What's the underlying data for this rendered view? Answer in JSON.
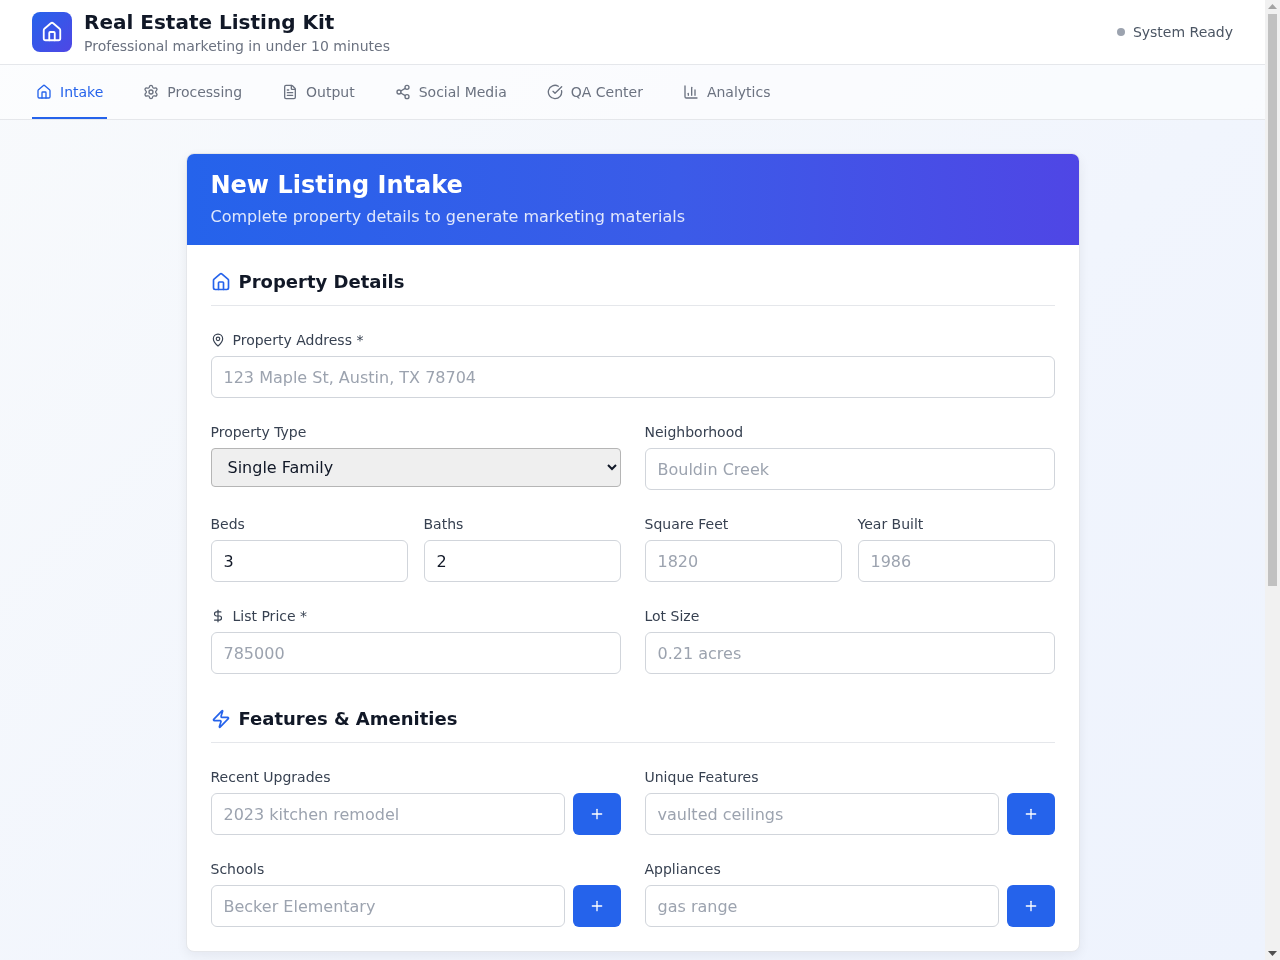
{
  "app": {
    "title": "Real Estate Listing Kit",
    "subtitle": "Professional marketing in under 10 minutes",
    "status": "System Ready"
  },
  "tabs": [
    {
      "label": "Intake",
      "selected": true
    },
    {
      "label": "Processing",
      "selected": false
    },
    {
      "label": "Output",
      "selected": false
    },
    {
      "label": "Social Media",
      "selected": false
    },
    {
      "label": "QA Center",
      "selected": false
    },
    {
      "label": "Analytics",
      "selected": false
    }
  ],
  "form": {
    "title": "New Listing Intake",
    "subtitle": "Complete property details to generate marketing materials",
    "sections": [
      {
        "heading": "Property Details",
        "rows": [
          {
            "fields": [
              {
                "kind": "address",
                "label": "Property Address *",
                "placeholder": "123 Maple St, Austin, TX 78704"
              }
            ]
          },
          {
            "fields": [
              {
                "kind": "select",
                "label": "Property Type",
                "value": "Single Family"
              },
              {
                "kind": "text",
                "label": "Neighborhood",
                "placeholder": "Bouldin Creek"
              }
            ]
          },
          {
            "fields": [
              {
                "kind": "text",
                "label": "Beds",
                "value": "3"
              },
              {
                "kind": "text",
                "label": "Baths",
                "value": "2"
              },
              {
                "kind": "text",
                "label": "Square Feet",
                "placeholder": "1820"
              },
              {
                "kind": "text",
                "label": "Year Built",
                "placeholder": "1986"
              }
            ]
          },
          {
            "fields": [
              {
                "kind": "money",
                "label": "List Price *",
                "placeholder": "785000"
              },
              {
                "kind": "text",
                "label": "Lot Size",
                "placeholder": "0.21 acres"
              }
            ]
          }
        ]
      },
      {
        "heading": "Features & Amenities",
        "rows": [
          {
            "fields": [
              {
                "kind": "entry",
                "label": "Recent Upgrades",
                "placeholder": "2023 kitchen remodel"
              },
              {
                "kind": "entry",
                "label": "Unique Features",
                "placeholder": "vaulted ceilings"
              }
            ]
          },
          {
            "fields": [
              {
                "kind": "entry",
                "label": "Schools",
                "placeholder": "Becker Elementary"
              },
              {
                "kind": "entry",
                "label": "Appliances",
                "placeholder": "gas range"
              }
            ]
          }
        ]
      }
    ]
  }
}
